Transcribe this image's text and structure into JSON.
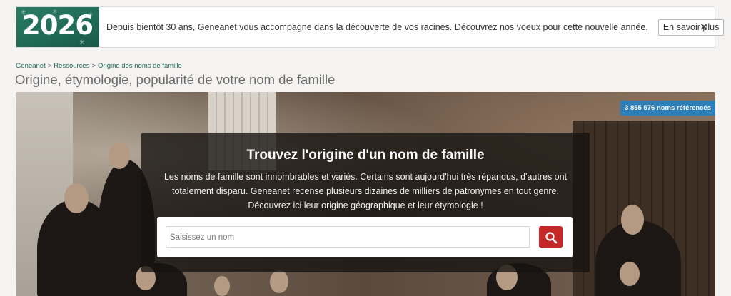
{
  "banner": {
    "logo_year": "2026",
    "message": "Depuis bientôt 30 ans, Geneanet vous accompagne dans la découverte de vos racines. Découvrez nos voeux pour cette nouvelle année.",
    "cta_label": "En savoir plus",
    "close_symbol": "×"
  },
  "breadcrumb": {
    "items": [
      "Geneanet",
      "Ressources",
      "Origine des noms de famille"
    ],
    "separator": ">"
  },
  "page": {
    "title": "Origine, étymologie, popularité de votre nom de famille"
  },
  "hero": {
    "badge": "3 855 576 noms référencés",
    "heading": "Trouvez l'origine d'un nom de famille",
    "description": "Les noms de famille sont innombrables et variés. Certains sont aujourd'hui très répandus, d'autres ont totalement disparu. Geneanet recense plusieurs dizaines de milliers de patronymes en tout genre. Découvrez ici leur origine géographique et leur étymologie !",
    "search": {
      "placeholder": "Saisissez un nom",
      "value": "",
      "button_icon": "search-icon"
    }
  },
  "colors": {
    "brand_green": "#1f6a55",
    "badge_blue": "#2e7fb8",
    "search_red": "#c62828"
  }
}
